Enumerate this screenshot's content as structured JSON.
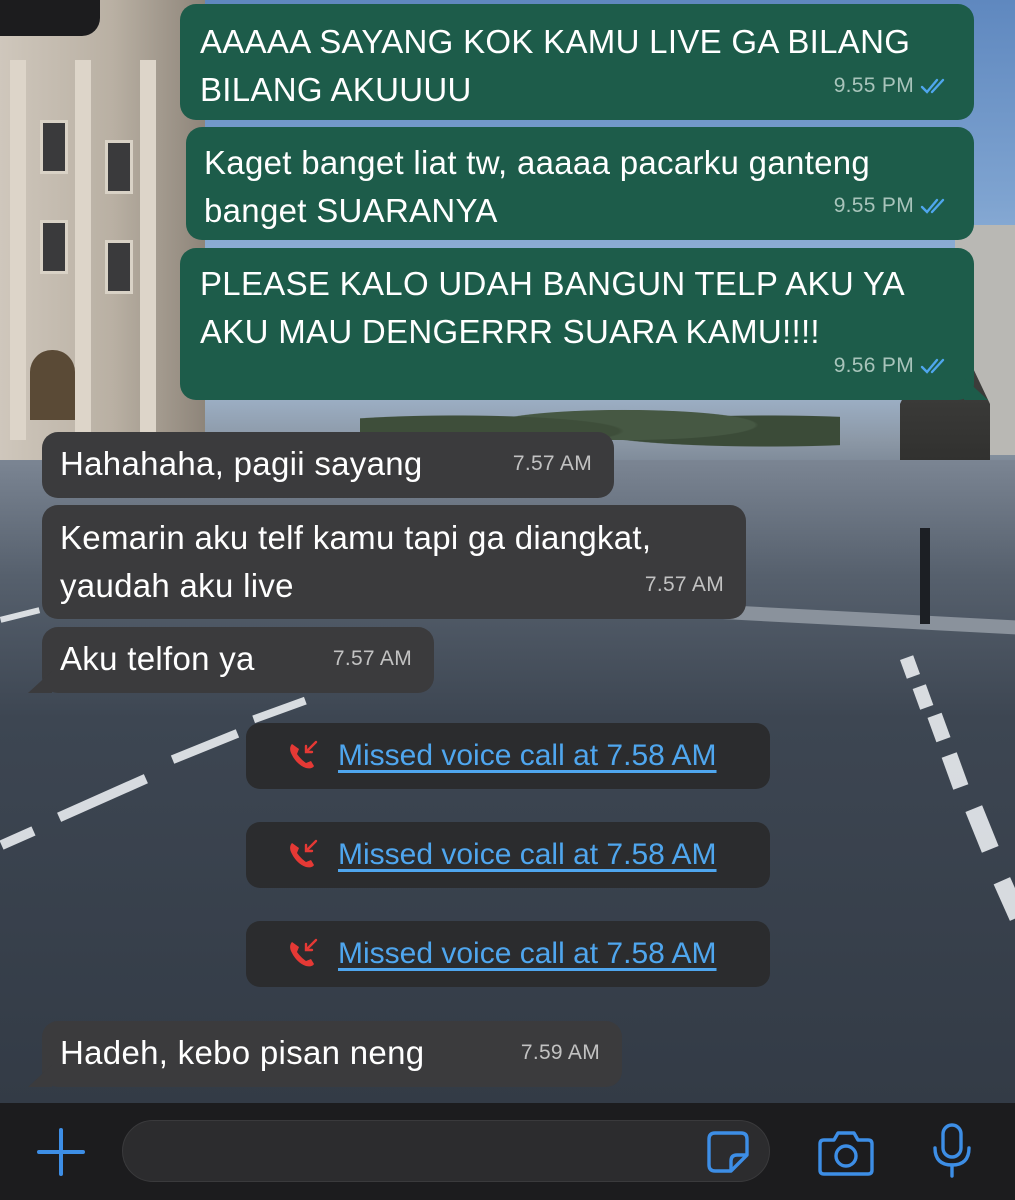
{
  "messages": [
    {
      "dir": "out",
      "text": "AAAAA SAYANG KOK KAMU LIVE GA BILANG\nBILANG AKUUUU",
      "time": "9.55 PM",
      "read": true
    },
    {
      "dir": "out",
      "text": "Kaget banget liat tw, aaaaa pacarku ganteng\nbanget SUARANYA",
      "time": "9.55 PM",
      "read": true
    },
    {
      "dir": "out",
      "text": "PLEASE KALO UDAH BANGUN TELP AKU YA\nAKU MAU DENGERRR SUARA KAMU!!!!",
      "time": "9.56 PM",
      "read": true
    },
    {
      "dir": "in",
      "text": "Hahahaha, pagii sayang",
      "time": "7.57 AM"
    },
    {
      "dir": "in",
      "text": "Kemarin aku telf kamu tapi ga diangkat,\nyaudah aku live",
      "time": "7.57 AM"
    },
    {
      "dir": "in",
      "text": "Aku telfon ya",
      "time": "7.57 AM"
    },
    {
      "dir": "in",
      "text": "Hadeh, kebo pisan neng",
      "time": "7.59 AM"
    }
  ],
  "missed_calls": [
    {
      "label": "Missed voice call at 7.58 AM",
      "icon": "missed-call-icon"
    },
    {
      "label": "Missed voice call at 7.58 AM",
      "icon": "missed-call-icon"
    },
    {
      "label": "Missed voice call at 7.58 AM",
      "icon": "missed-call-icon"
    }
  ],
  "input_bar": {
    "message_value": "",
    "icons": [
      "plus-icon",
      "sticker-icon",
      "camera-icon",
      "microphone-icon"
    ]
  },
  "colors": {
    "outgoing_bubble": "#1d5c4a",
    "incoming_bubble": "#3b3b3d",
    "read_ticks": "#4fa6ee",
    "link": "#4fa6ee",
    "missed_call": "#e53935",
    "accent_icons": "#3d8ee6"
  }
}
